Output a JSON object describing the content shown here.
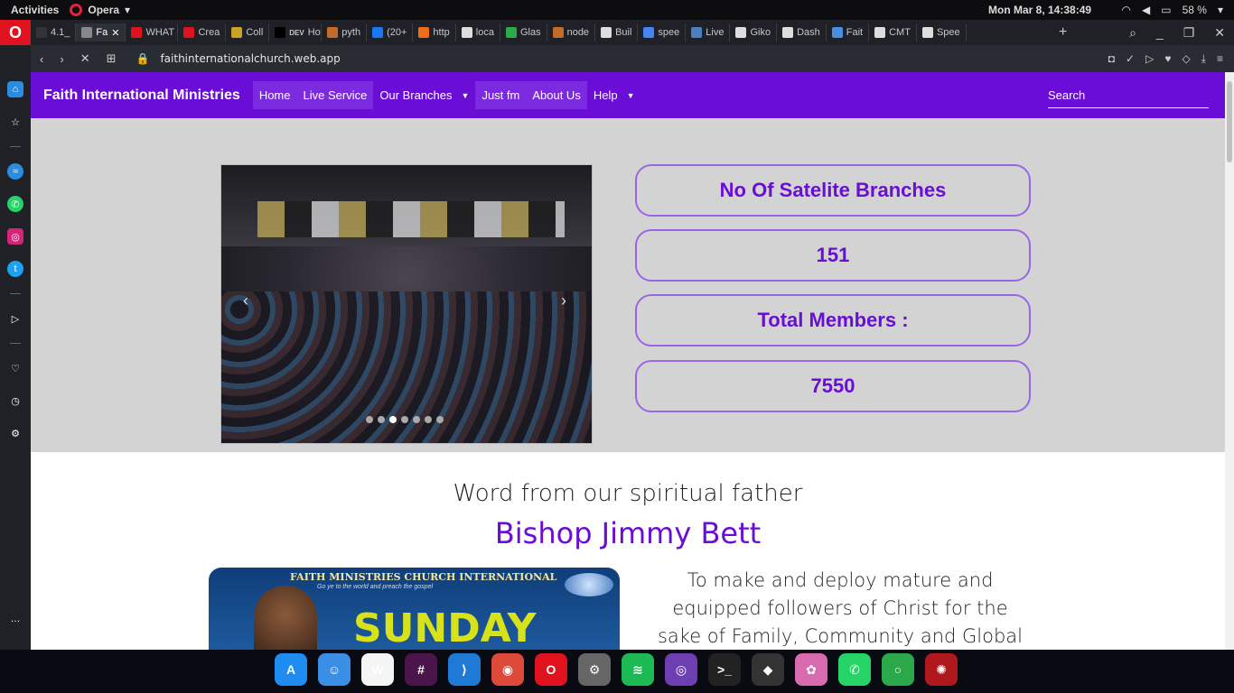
{
  "system": {
    "activities": "Activities",
    "app_name": "Opera",
    "clock": "Mon Mar  8, 14:38:49",
    "battery": "58 %"
  },
  "tabs": [
    {
      "label": "4.1_",
      "color": "#333"
    },
    {
      "label": "Fa",
      "color": "#888"
    },
    {
      "label": "WHAT",
      "color": "#e0121e"
    },
    {
      "label": "Crea",
      "color": "#e0121e"
    },
    {
      "label": "Coll",
      "color": "#c9a227"
    },
    {
      "label": "How",
      "color": "#000"
    },
    {
      "label": "pyth",
      "color": "#c46a2a"
    },
    {
      "label": "(20+",
      "color": "#1877f2"
    },
    {
      "label": "http",
      "color": "#f06c1a"
    },
    {
      "label": "loca",
      "color": "#ddd"
    },
    {
      "label": "Glas",
      "color": "#2aa84a"
    },
    {
      "label": "node",
      "color": "#c46a2a"
    },
    {
      "label": "Buil",
      "color": "#ddd"
    },
    {
      "label": "spee",
      "color": "#4285f4"
    },
    {
      "label": "Live",
      "color": "#4a7fc0"
    },
    {
      "label": "Giko",
      "color": "#ddd"
    },
    {
      "label": "Dash",
      "color": "#ddd"
    },
    {
      "label": "Fait",
      "color": "#4a90e2"
    },
    {
      "label": "CMT",
      "color": "#ddd"
    },
    {
      "label": "Spee",
      "color": "#ddd"
    }
  ],
  "tab_prefixes": {
    "dev": "DEV"
  },
  "address": {
    "url": "faithinternationalchurch.web.app"
  },
  "site": {
    "brand": "Faith International Ministries",
    "nav": {
      "home": "Home",
      "live": "Live Service",
      "branches": "Our Branches",
      "justfm": "Just fm",
      "about": "About Us",
      "help": "Help"
    },
    "search_placeholder": "Search",
    "stats": {
      "branches_label": "No Of Satelite Branches",
      "branches_value": "151",
      "members_label": "Total Members :",
      "members_value": "7550"
    },
    "carousel": {
      "slide_count": 7,
      "active_slide": 3,
      "prev": "‹",
      "next": "›"
    },
    "word_heading": "Word from our spiritual father",
    "bishop_name": "Bishop Jimmy Bett",
    "poster": {
      "title": "FAITH MINISTRIES CHURCH INTERNATIONAL",
      "subtitle": "Go ye to the world and preach the gospel",
      "day": "SUNDAY"
    },
    "mission": "To make and deploy mature and equipped followers of Christ for the sake of Family, Community and Global Transformation. At"
  },
  "dock": [
    {
      "name": "appstore-icon",
      "color": "#1e8cf0",
      "glyph": "A"
    },
    {
      "name": "finder-icon",
      "color": "#3a8ee6",
      "glyph": "☺"
    },
    {
      "name": "writer-icon",
      "color": "#f5f5f5",
      "glyph": "W"
    },
    {
      "name": "slack-icon",
      "color": "#4a154b",
      "glyph": "#"
    },
    {
      "name": "vscode-icon",
      "color": "#1f7ad6",
      "glyph": "⟩"
    },
    {
      "name": "chrome-icon",
      "color": "#dd4a3a",
      "glyph": "◉"
    },
    {
      "name": "opera-icon",
      "color": "#e0121e",
      "glyph": "O"
    },
    {
      "name": "settings-icon",
      "color": "#666",
      "glyph": "⚙"
    },
    {
      "name": "spotify-icon",
      "color": "#1db954",
      "glyph": "≋"
    },
    {
      "name": "github-icon",
      "color": "#6e3fb0",
      "glyph": "◎"
    },
    {
      "name": "terminal-icon",
      "color": "#222",
      "glyph": ">_"
    },
    {
      "name": "cube-icon",
      "color": "#333",
      "glyph": "◆"
    },
    {
      "name": "photos-icon",
      "color": "#d86bb0",
      "glyph": "✿"
    },
    {
      "name": "whatsapp-icon",
      "color": "#25d366",
      "glyph": "✆"
    },
    {
      "name": "ring-icon",
      "color": "#2aa84a",
      "glyph": "○"
    },
    {
      "name": "web-icon",
      "color": "#b0181e",
      "glyph": "✺"
    }
  ]
}
